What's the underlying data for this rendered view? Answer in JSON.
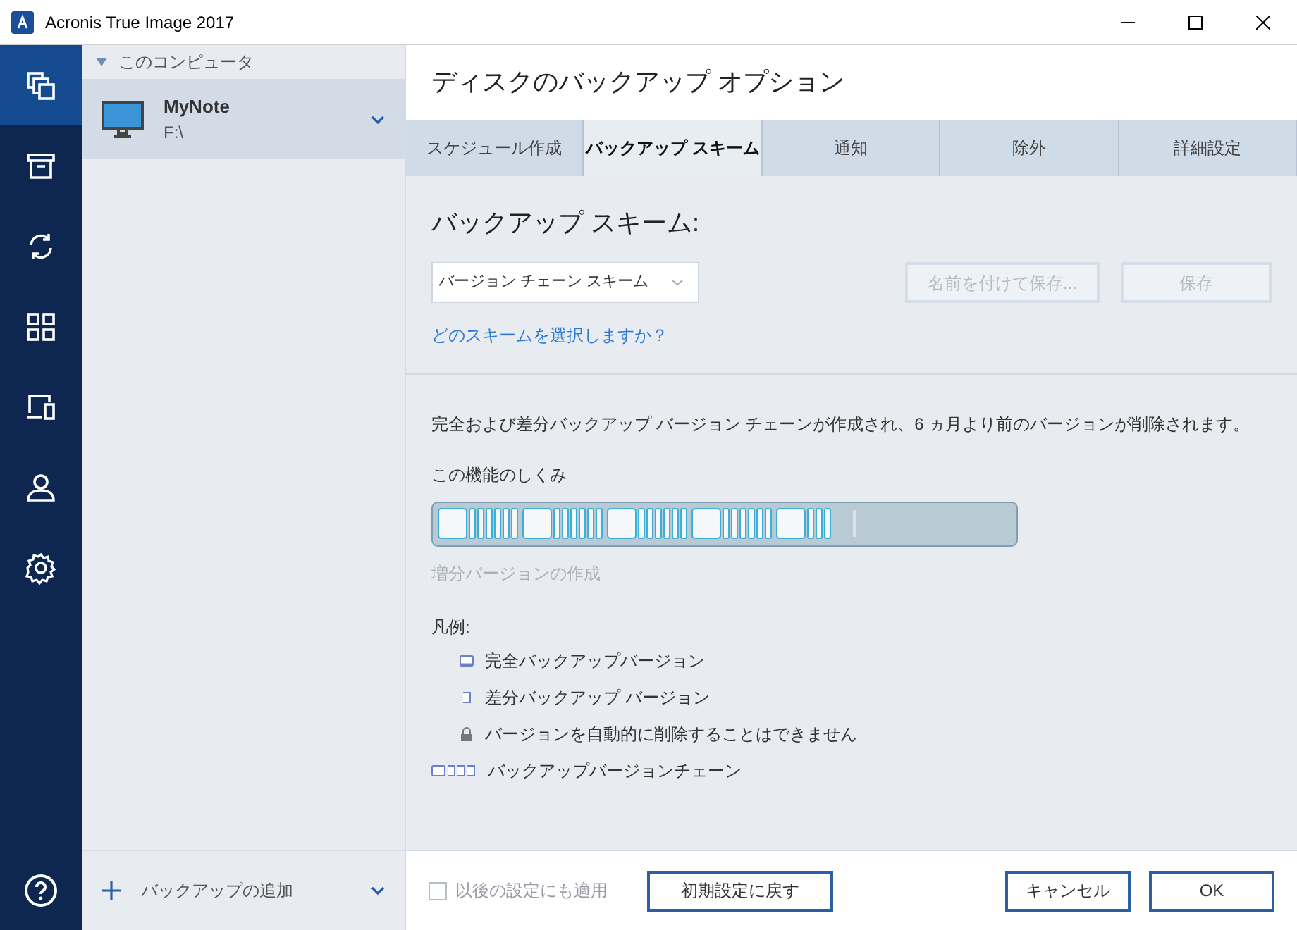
{
  "window": {
    "title": "Acronis True Image 2017"
  },
  "nav": [
    {
      "selected": true
    },
    {
      "selected": false
    },
    {
      "selected": false
    },
    {
      "selected": false
    },
    {
      "selected": false
    },
    {
      "selected": false
    },
    {
      "selected": false
    }
  ],
  "source_list": {
    "group": "このコンピュータ",
    "expanded": true,
    "items": [
      {
        "name": "MyNote",
        "path": "F:\\",
        "selected": true
      }
    ]
  },
  "add_backup": "バックアップの追加",
  "page_title": "ディスクのバックアップ オプション",
  "tabs": [
    {
      "label": "スケジュール作成",
      "selected": false
    },
    {
      "label": "バックアップ スキーム",
      "selected": true
    },
    {
      "label": "通知",
      "selected": false
    },
    {
      "label": "除外",
      "selected": false
    },
    {
      "label": "詳細設定",
      "selected": false
    }
  ],
  "scheme": {
    "heading": "バックアップ スキーム:",
    "dropdown": "バージョン チェーン スキーム",
    "buttons": [
      {
        "label": "名前を付けて保存...",
        "disabled": true
      },
      {
        "label": "保存",
        "disabled": true
      }
    ],
    "help_link": "どのスキームを選択しますか？"
  },
  "description": "完全および差分バックアップ バージョン チェーンが作成され、6 ヵ月より前のバージョンが削除されます。",
  "how_it_works": "この機能のしくみ",
  "diagram_caption": "増分バージョンの作成",
  "legend": {
    "title": "凡例:",
    "items": [
      {
        "kind": "full",
        "label": "完全バックアップバージョン"
      },
      {
        "kind": "diff",
        "label": "差分バックアップ バージョン"
      },
      {
        "kind": "lock",
        "label": "バージョンを自動的に削除することはできません"
      },
      {
        "kind": "chain",
        "label": "バックアップバージョンチェーン"
      }
    ]
  },
  "footer": {
    "apply_later": {
      "label": "以後の設定にも適用",
      "checked": false
    },
    "reset": "初期設定に戻す",
    "cancel": "キャンセル",
    "ok": "OK"
  }
}
